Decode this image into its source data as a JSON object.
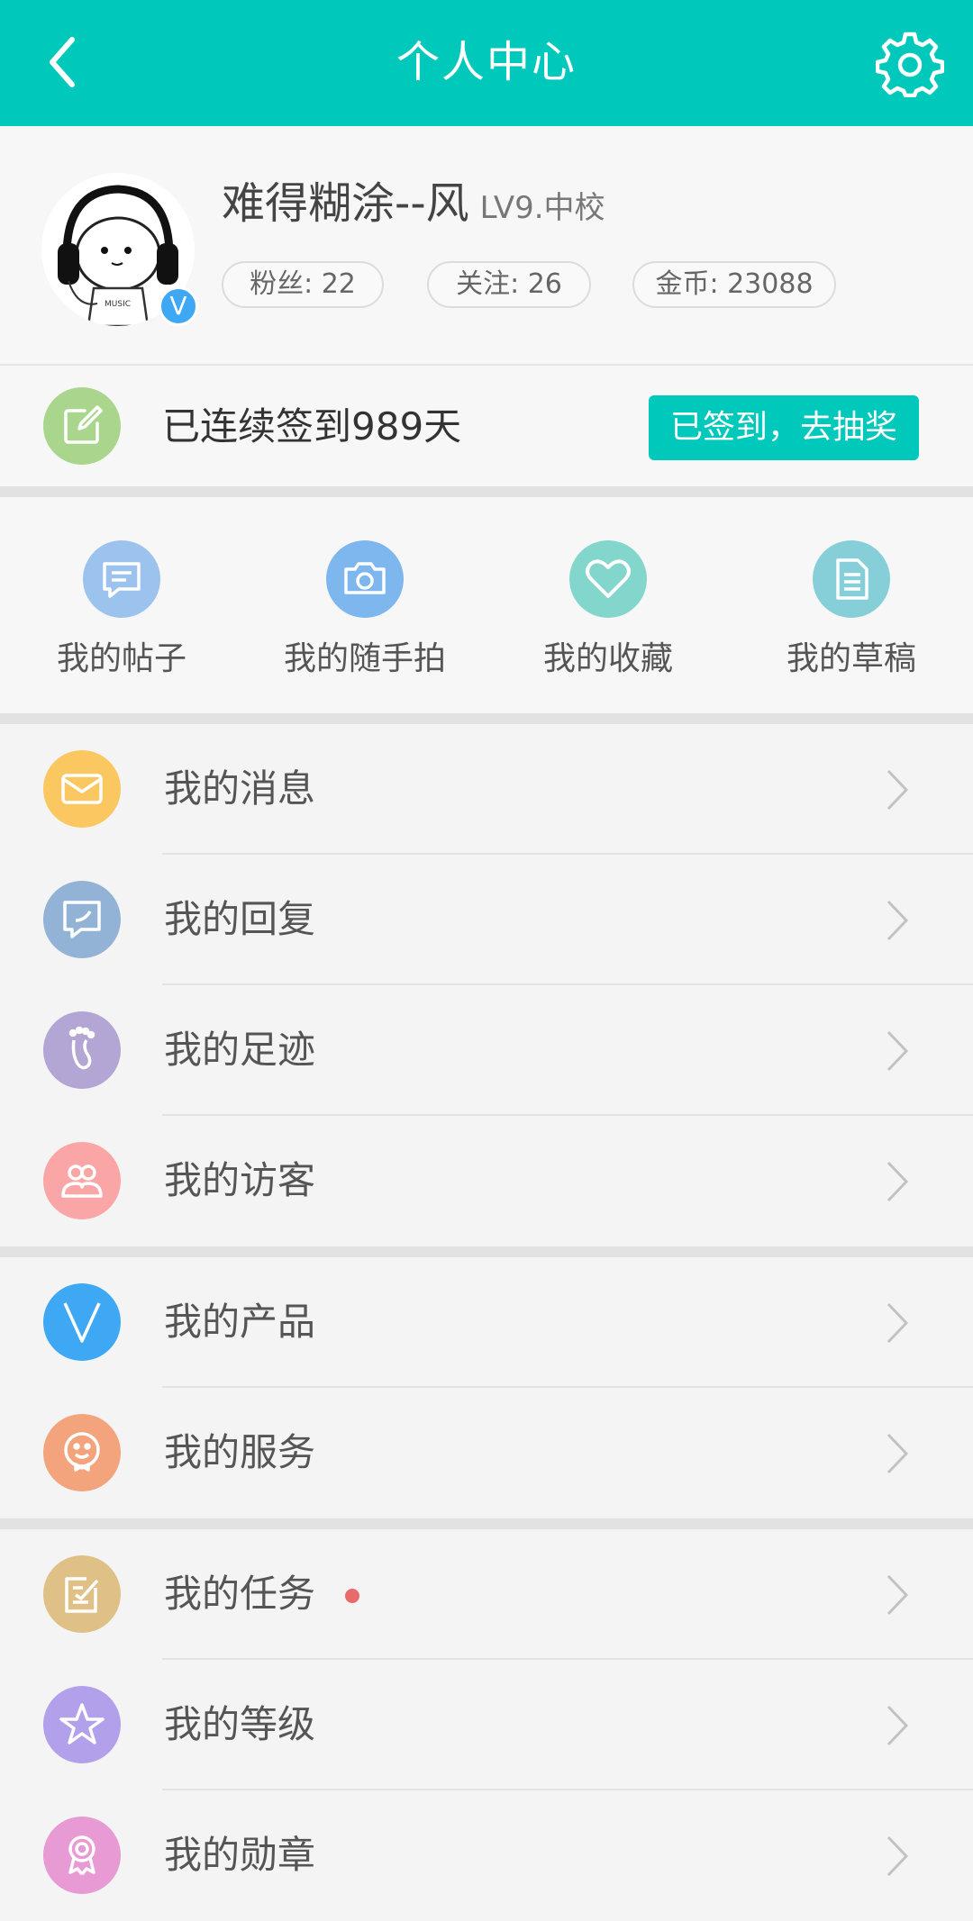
{
  "header": {
    "title": "个人中心",
    "back_icon": "back-arrow-icon",
    "settings_icon": "gear-icon",
    "bg_color": "#00c8bb"
  },
  "profile": {
    "username": "难得糊涂--风",
    "level": "LV9.中校",
    "verified_badge": "V",
    "fans": "粉丝: 22",
    "follows": "关注: 26",
    "coins": "金币: 23088"
  },
  "signin": {
    "streak_text": "已连续签到989天",
    "button_label": "已签到，去抽奖",
    "icon": "edit-icon"
  },
  "shortcuts": [
    {
      "label": "我的帖子",
      "icon": "post-icon",
      "color": "#9cc3ee"
    },
    {
      "label": "我的随手拍",
      "icon": "camera-icon",
      "color": "#7eb6ee"
    },
    {
      "label": "我的收藏",
      "icon": "heart-icon",
      "color": "#82d6cc"
    },
    {
      "label": "我的草稿",
      "icon": "draft-icon",
      "color": "#86cfd8"
    }
  ],
  "menu": [
    {
      "label": "我的消息",
      "icon": "mail-icon",
      "color": "#fbc760"
    },
    {
      "label": "我的回复",
      "icon": "reply-icon",
      "color": "#93b3d6"
    },
    {
      "label": "我的足迹",
      "icon": "footprint-icon",
      "color": "#b3a5d4"
    },
    {
      "label": "我的访客",
      "icon": "visitors-icon",
      "color": "#fba6a6"
    },
    {
      "label": "我的产品",
      "icon": "v-brand-icon",
      "color": "#3ea8f4"
    },
    {
      "label": "我的服务",
      "icon": "smile-service-icon",
      "color": "#f4a47c"
    },
    {
      "label": "我的任务",
      "icon": "task-icon",
      "color": "#dfc086",
      "has_dot": true
    },
    {
      "label": "我的等级",
      "icon": "star-icon",
      "color": "#b3a0ea"
    },
    {
      "label": "我的勋章",
      "icon": "medal-icon",
      "color": "#e89ad4"
    }
  ]
}
